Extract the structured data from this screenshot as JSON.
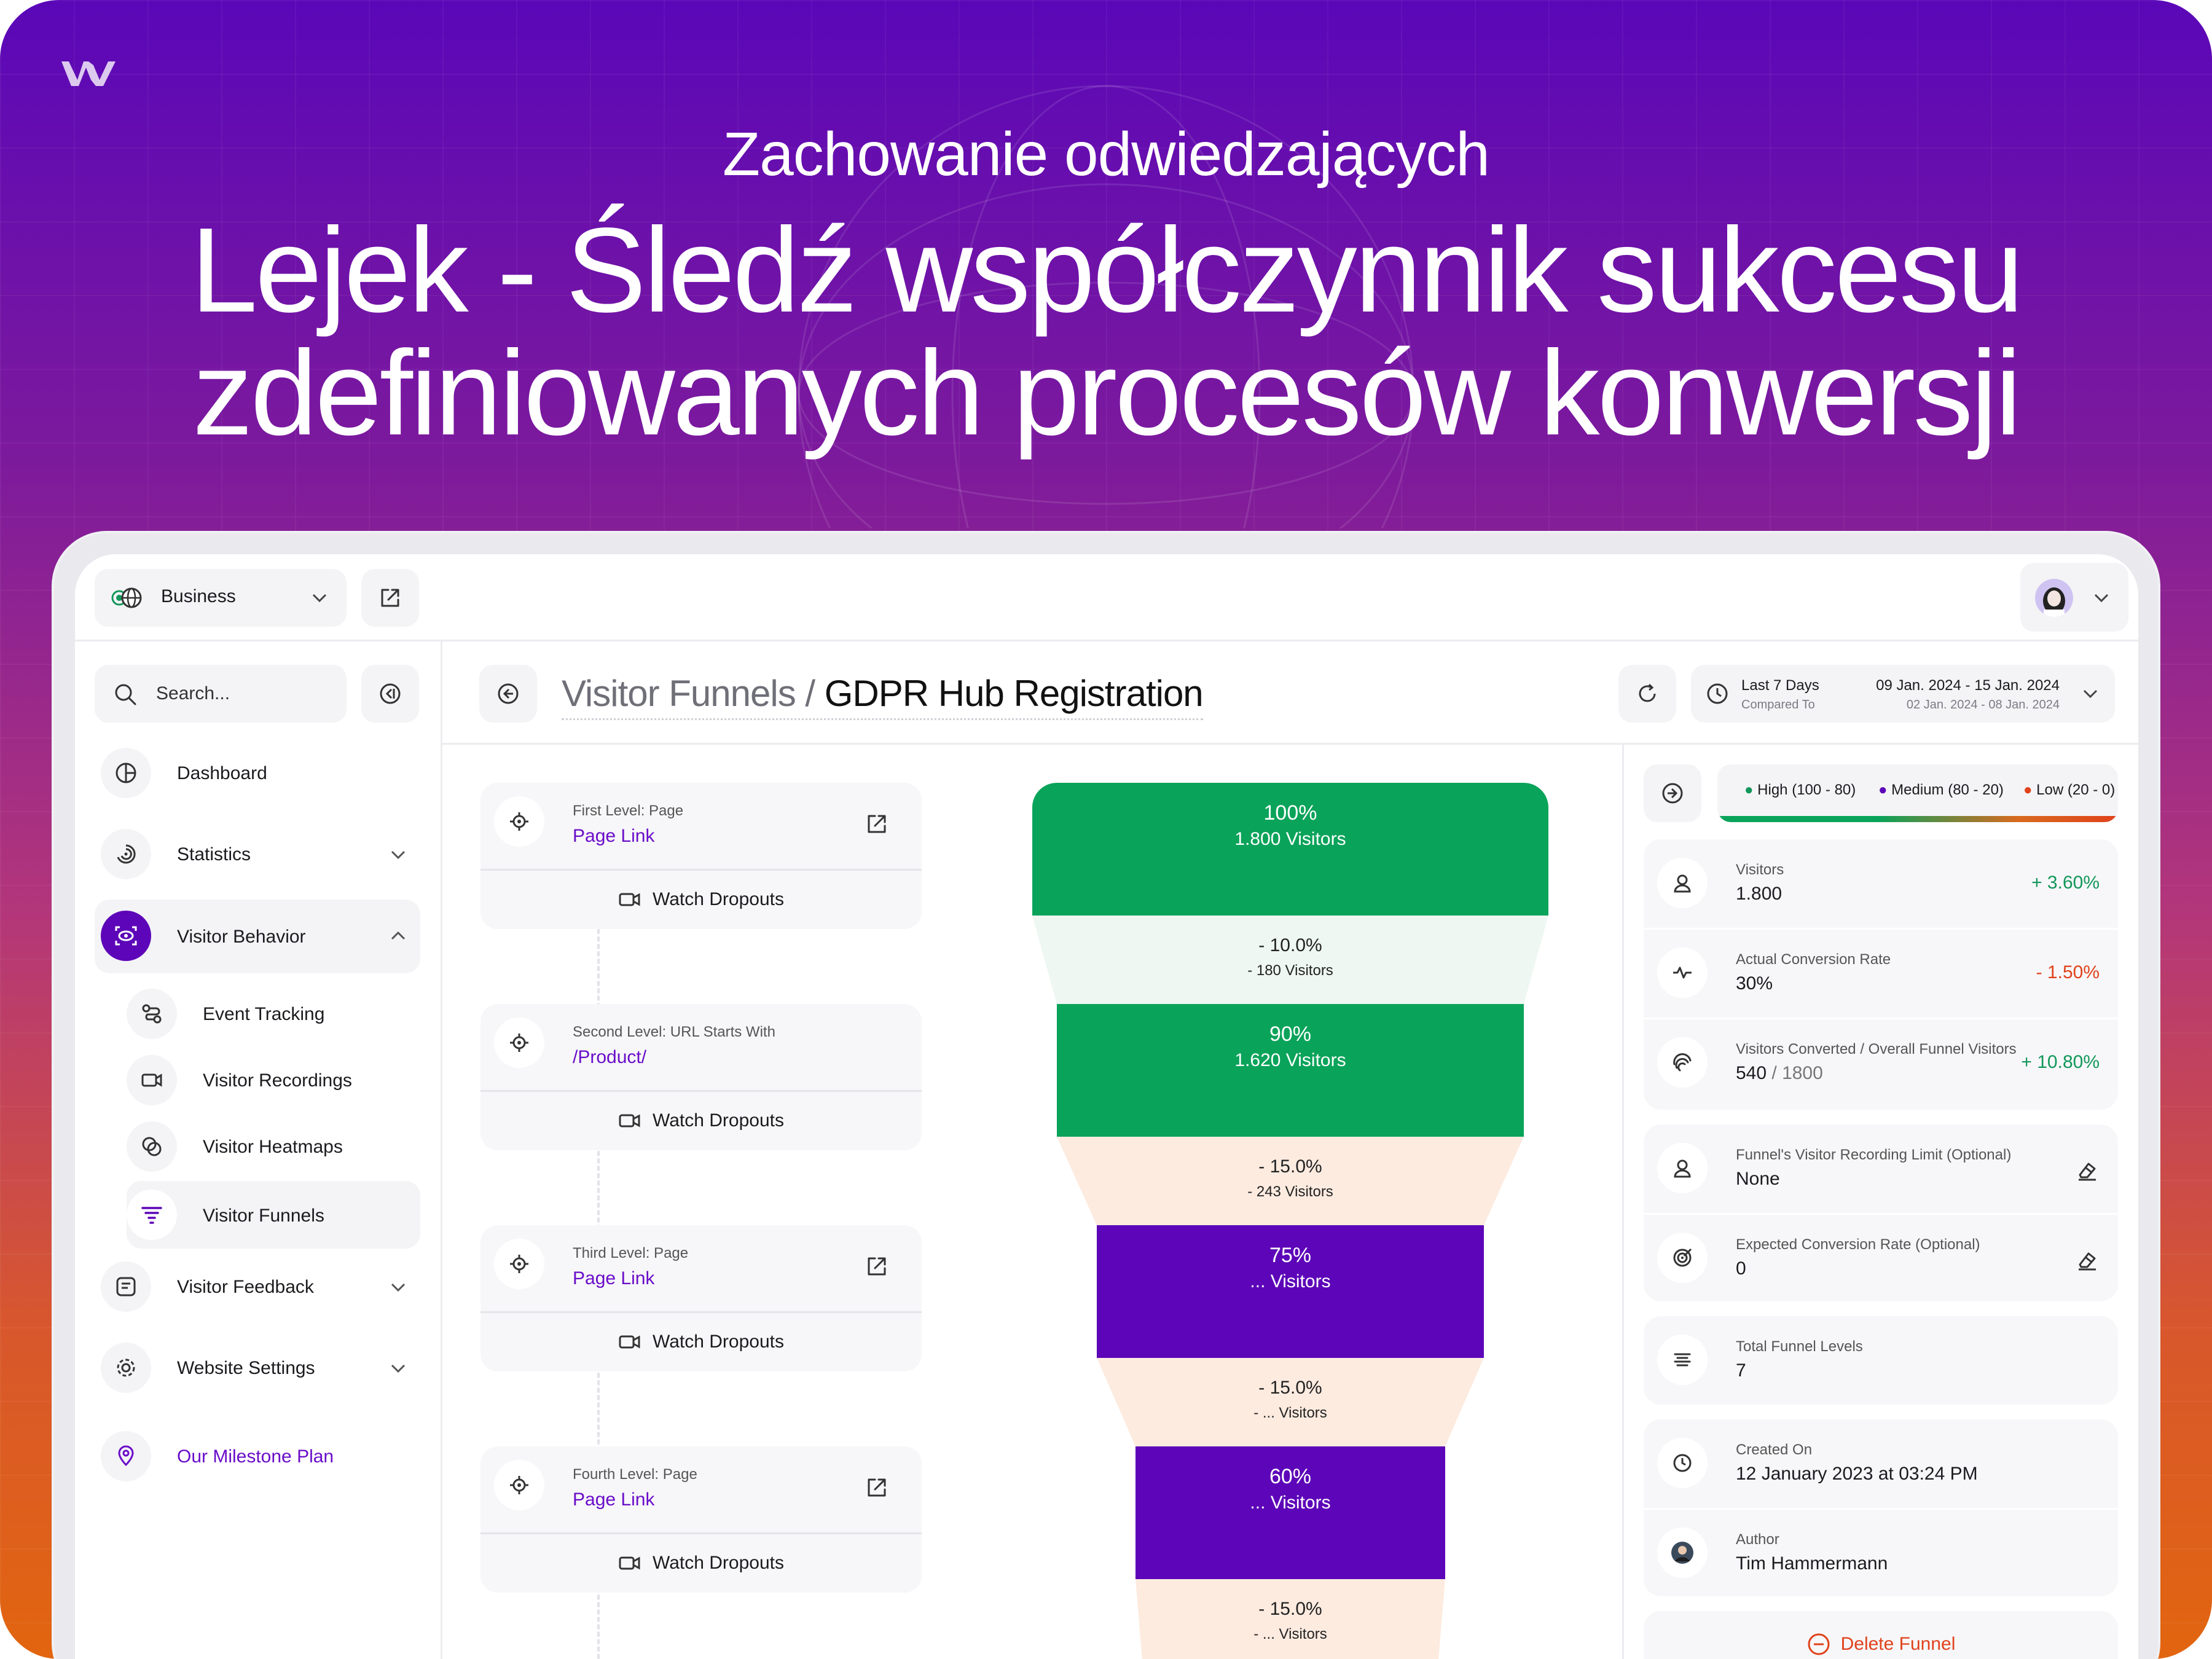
{
  "hero": {
    "subtitle": "Zachowanie odwiedzających",
    "title_line1": "Lejek - Śledź współczynnik sukcesu",
    "title_line2": "zdefiniowanych procesów konwersji"
  },
  "topbar": {
    "workspace": "Business"
  },
  "sidebar": {
    "search_placeholder": "Search...",
    "items": [
      {
        "label": "Dashboard"
      },
      {
        "label": "Statistics"
      },
      {
        "label": "Visitor Behavior"
      },
      {
        "label": "Event Tracking"
      },
      {
        "label": "Visitor Recordings"
      },
      {
        "label": "Visitor Heatmaps"
      },
      {
        "label": "Visitor Funnels"
      },
      {
        "label": "Visitor Feedback"
      },
      {
        "label": "Website Settings"
      },
      {
        "label": "Our Milestone Plan"
      }
    ]
  },
  "header": {
    "breadcrumb_parent": "Visitor Funnels",
    "breadcrumb_sep": "/",
    "breadcrumb_current": "GDPR Hub Registration",
    "range_label": "Last 7 Days",
    "range_value": "09 Jan. 2024 - 15 Jan. 2024",
    "compare_label": "Compared To",
    "compare_value": "02 Jan. 2024 - 08 Jan. 2024"
  },
  "levels": [
    {
      "type": "First Level: Page",
      "value": "Page Link",
      "action": "Watch Dropouts"
    },
    {
      "type": "Second Level: URL Starts With",
      "value": "/Product/",
      "action": "Watch Dropouts"
    },
    {
      "type": "Third Level: Page",
      "value": "Page Link",
      "action": "Watch Dropouts"
    },
    {
      "type": "Fourth Level: Page",
      "value": "Page Link",
      "action": "Watch Dropouts"
    }
  ],
  "funnel": {
    "stages": [
      {
        "pct": "100%",
        "visitors": "1.800 Visitors",
        "color": "#0aa35a"
      },
      {
        "pct": "90%",
        "visitors": "1.620 Visitors",
        "color": "#0aa35a"
      },
      {
        "pct": "75%",
        "visitors": "... Visitors",
        "color": "#5d05b8"
      },
      {
        "pct": "60%",
        "visitors": "... Visitors",
        "color": "#5d05b8"
      }
    ],
    "drops": [
      {
        "pct": "- 10.0%",
        "visitors": "- 180 Visitors",
        "color": "#eef7f2"
      },
      {
        "pct": "- 15.0%",
        "visitors": "- 243 Visitors",
        "color": "#fdebe0"
      },
      {
        "pct": "- 15.0%",
        "visitors": "- ... Visitors",
        "color": "#fdebe0"
      },
      {
        "pct": "- 15.0%",
        "visitors": "- ... Visitors",
        "color": "#fdebe0"
      }
    ]
  },
  "legend": {
    "high": "High (100 - 80)",
    "medium": "Medium (80 - 20)",
    "low": "Low (20 - 0)"
  },
  "stats": {
    "visitors_label": "Visitors",
    "visitors_value": "1.800",
    "visitors_change": "+ 3.60%",
    "conv_label": "Actual Conversion Rate",
    "conv_value": "30%",
    "conv_change": "- 1.50%",
    "converted_label": "Visitors Converted / Overall Funnel Visitors",
    "converted_value": "540",
    "converted_total": " / 1800",
    "converted_change": "+ 10.80%",
    "limit_label": "Funnel's Visitor Recording Limit (Optional)",
    "limit_value": "None",
    "expected_label": "Expected Conversion Rate (Optional)",
    "expected_value": "0",
    "levels_label": "Total Funnel Levels",
    "levels_value": "7",
    "created_label": "Created On",
    "created_value": "12 January 2023 at 03:24 PM",
    "author_label": "Author",
    "author_value": "Tim Hammermann",
    "delete_label": "Delete Funnel"
  }
}
